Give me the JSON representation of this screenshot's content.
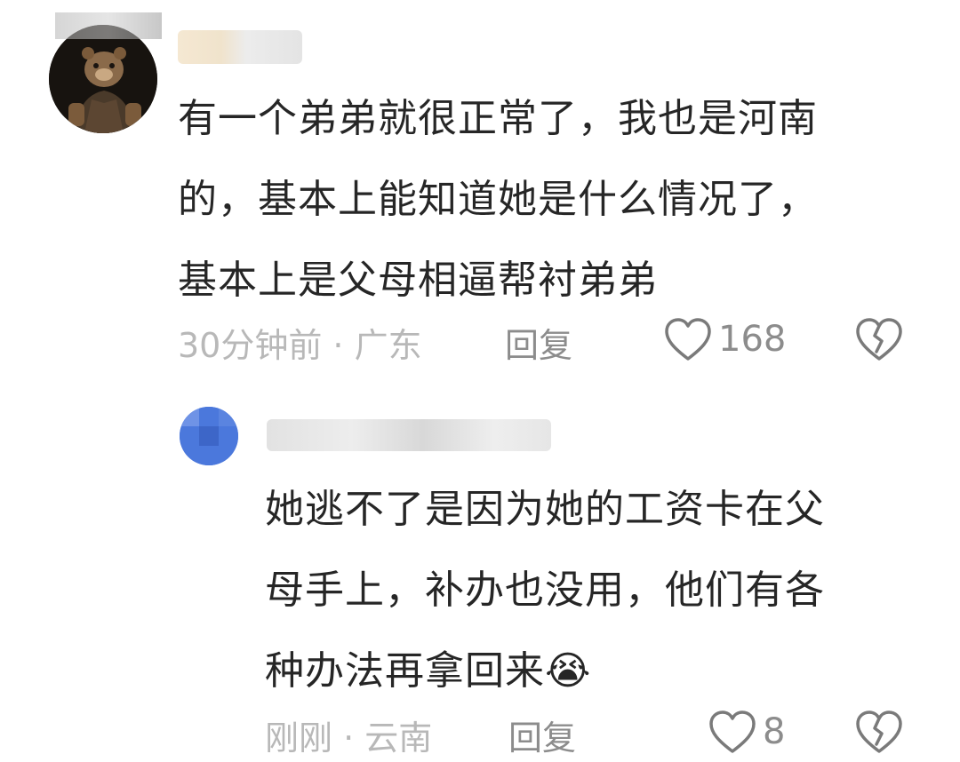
{
  "comments": [
    {
      "text": "有一个弟弟就很正常了，我也是河南\n的，基本上能知道她是什么情况了，\n基本上是父母相逼帮衬弟弟",
      "time": "30分钟前",
      "location": "广东",
      "meta": "30分钟前 · 广东",
      "reply_label": "回复",
      "likes": "168",
      "avatar_desc": "bear-avatar"
    },
    {
      "text": "她逃不了是因为她的工资卡在父\n母手上，补办也没用，他们有各\n种办法再拿回来😭",
      "time": "刚刚",
      "location": "云南",
      "meta": "刚刚 · 云南",
      "reply_label": "回复",
      "likes": "8",
      "avatar_desc": "blue-avatar"
    }
  ],
  "colors": {
    "text": "#262626",
    "meta": "#b8b8b8",
    "secondary": "#8c8c8c",
    "icon_stroke": "#7a7a7a"
  }
}
